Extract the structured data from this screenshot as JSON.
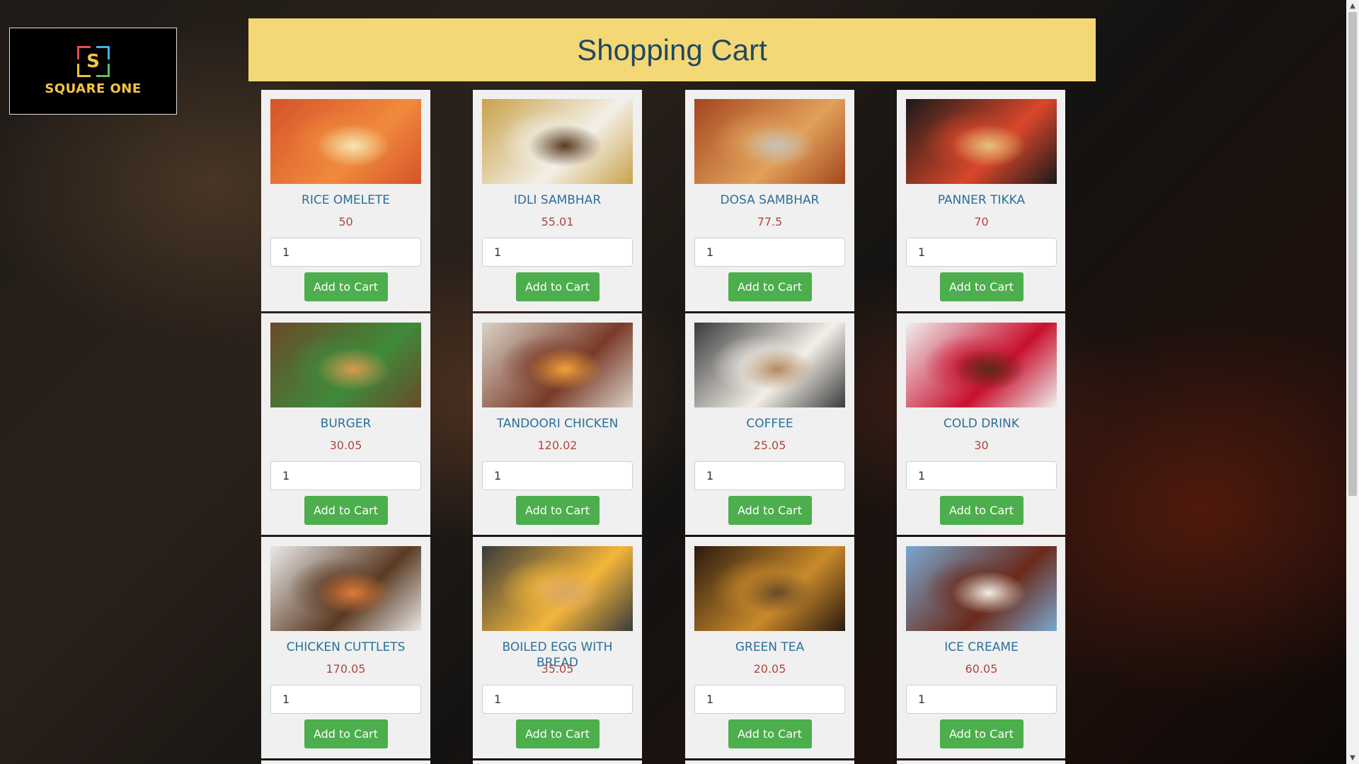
{
  "logo": {
    "text": "SQUARE ONE",
    "mark_letter": "S"
  },
  "header": {
    "title": "Shopping Cart"
  },
  "button_label": "Add to Cart",
  "scrollbar": {
    "up_icon": "▲",
    "down_icon": "▼"
  },
  "products": [
    {
      "name": "RICE OMELETE",
      "price": "50",
      "qty": "1",
      "image": "rice-omelete-photo",
      "colors": [
        "#d5532a",
        "#f08a3c",
        "#f5e6b0"
      ]
    },
    {
      "name": "IDLI SAMBHAR",
      "price": "55.01",
      "qty": "1",
      "image": "idli-sambhar-photo",
      "colors": [
        "#c9a24a",
        "#f3f0e8",
        "#5a3a20"
      ]
    },
    {
      "name": "DOSA SAMBHAR",
      "price": "77.5",
      "qty": "1",
      "image": "dosa-sambhar-photo",
      "colors": [
        "#a5461f",
        "#e1a15a",
        "#c9c2b8"
      ]
    },
    {
      "name": "PANNER TIKKA",
      "price": "70",
      "qty": "1",
      "image": "panner-tikka-photo",
      "colors": [
        "#1a1a1a",
        "#d9472a",
        "#e5c27a"
      ]
    },
    {
      "name": "BURGER",
      "price": "30.05",
      "qty": "1",
      "image": "burger-photo",
      "colors": [
        "#6a4a2a",
        "#3f8a3a",
        "#d89a50"
      ]
    },
    {
      "name": "TANDOORI CHICKEN",
      "price": "120.02",
      "qty": "1",
      "image": "tandoori-chicken-photo",
      "colors": [
        "#d9d3c8",
        "#7a3a28",
        "#f0a33a"
      ]
    },
    {
      "name": "COFFEE",
      "price": "25.05",
      "qty": "1",
      "image": "coffee-photo",
      "colors": [
        "#3a3a3a",
        "#f3efe8",
        "#b48a60"
      ]
    },
    {
      "name": "COLD DRINK",
      "price": "30",
      "qty": "1",
      "image": "cold-drink-photo",
      "colors": [
        "#efefef",
        "#c8102e",
        "#5a2a18"
      ]
    },
    {
      "name": "CHICKEN CUTTLETS",
      "price": "170.05",
      "qty": "1",
      "image": "chicken-cuttlets-photo",
      "colors": [
        "#e9e9e9",
        "#5a3a22",
        "#e07a3a"
      ]
    },
    {
      "name": "BOILED EGG WITH BREAD",
      "price": "35.05",
      "qty": "1",
      "image": "boiled-egg-with-bread-photo",
      "colors": [
        "#3a3a3a",
        "#f4b63a",
        "#d9a66a"
      ]
    },
    {
      "name": "GREEN TEA",
      "price": "20.05",
      "qty": "1",
      "image": "green-tea-photo",
      "colors": [
        "#2a1a10",
        "#c98a2a",
        "#6a4a28"
      ]
    },
    {
      "name": "ICE CREAME",
      "price": "60.05",
      "qty": "1",
      "image": "ice-creame-photo",
      "colors": [
        "#7aa8d0",
        "#6a2a1a",
        "#f3eee6"
      ]
    }
  ]
}
